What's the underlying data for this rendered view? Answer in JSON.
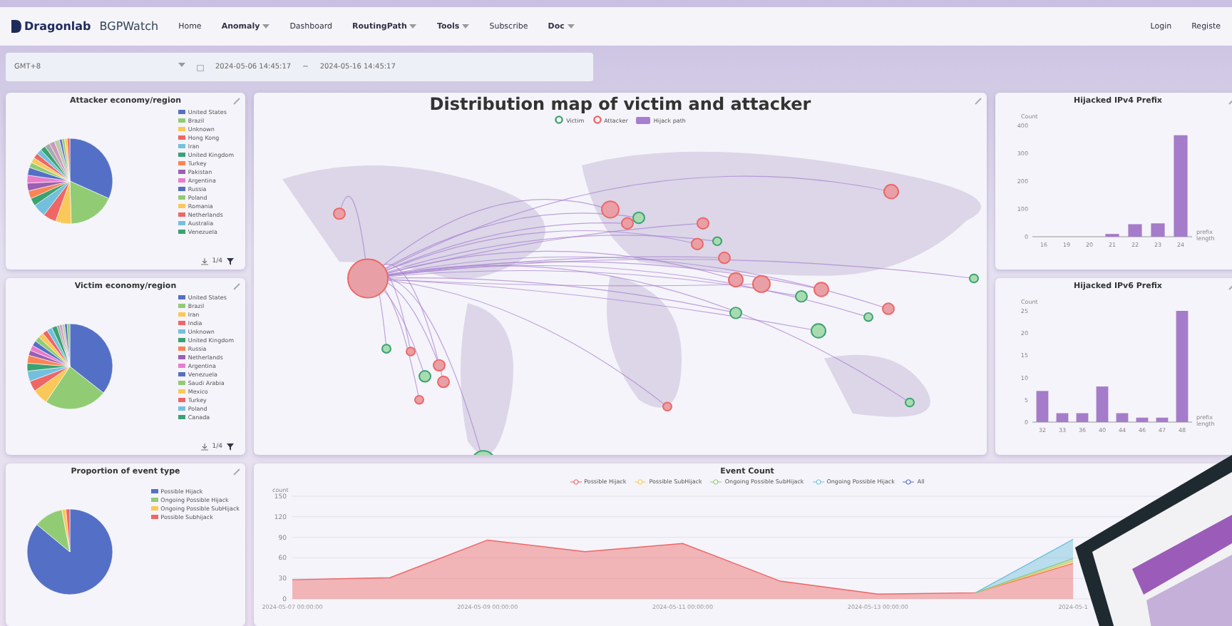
{
  "nav": {
    "brand": "Dragonlab",
    "product": "BGPWatch",
    "items": [
      {
        "label": "Home",
        "bold": false,
        "dropdown": false
      },
      {
        "label": "Anomaly",
        "bold": true,
        "dropdown": true
      },
      {
        "label": "Dashboard",
        "bold": false,
        "dropdown": false
      },
      {
        "label": "RoutingPath",
        "bold": true,
        "dropdown": true
      },
      {
        "label": "Tools",
        "bold": true,
        "dropdown": true
      },
      {
        "label": "Subscribe",
        "bold": false,
        "dropdown": false
      },
      {
        "label": "Doc",
        "bold": true,
        "dropdown": true
      }
    ],
    "right": [
      "Login",
      "Registe"
    ]
  },
  "filter": {
    "timezone": "GMT+8",
    "start": "2024-05-06 14:45:17",
    "separator": "~",
    "end": "2024-05-16 14:45:17"
  },
  "attacker_panel": {
    "title": "Attacker economy/region",
    "page": "1/4",
    "legend": [
      {
        "label": "United States",
        "color": "#5470c6"
      },
      {
        "label": "Brazil",
        "color": "#91cc75"
      },
      {
        "label": "Unknown",
        "color": "#fac858"
      },
      {
        "label": "Hong Kong",
        "color": "#ee6666"
      },
      {
        "label": "Iran",
        "color": "#73c0de"
      },
      {
        "label": "United Kingdom",
        "color": "#3ba272"
      },
      {
        "label": "Turkey",
        "color": "#fc8452"
      },
      {
        "label": "Pakistan",
        "color": "#9a60b4"
      },
      {
        "label": "Argentina",
        "color": "#ea7ccc"
      },
      {
        "label": "Russia",
        "color": "#5470c6"
      },
      {
        "label": "Poland",
        "color": "#91cc75"
      },
      {
        "label": "Romania",
        "color": "#fac858"
      },
      {
        "label": "Netherlands",
        "color": "#ee6666"
      },
      {
        "label": "Australia",
        "color": "#73c0de"
      },
      {
        "label": "Venezuela",
        "color": "#3ba272"
      }
    ]
  },
  "victim_panel": {
    "title": "Victim economy/region",
    "page": "1/4",
    "legend": [
      {
        "label": "United States",
        "color": "#5470c6"
      },
      {
        "label": "Brazil",
        "color": "#91cc75"
      },
      {
        "label": "Iran",
        "color": "#fac858"
      },
      {
        "label": "India",
        "color": "#ee6666"
      },
      {
        "label": "Unknown",
        "color": "#73c0de"
      },
      {
        "label": "United Kingdom",
        "color": "#3ba272"
      },
      {
        "label": "Russia",
        "color": "#fc8452"
      },
      {
        "label": "Netherlands",
        "color": "#9a60b4"
      },
      {
        "label": "Argentina",
        "color": "#ea7ccc"
      },
      {
        "label": "Venezuela",
        "color": "#5470c6"
      },
      {
        "label": "Saudi Arabia",
        "color": "#91cc75"
      },
      {
        "label": "Mexico",
        "color": "#fac858"
      },
      {
        "label": "Turkey",
        "color": "#ee6666"
      },
      {
        "label": "Poland",
        "color": "#73c0de"
      },
      {
        "label": "Canada",
        "color": "#3ba272"
      }
    ]
  },
  "map_panel": {
    "title": "Distribution map of victim and attacker",
    "legend": [
      {
        "label": "Victim",
        "kind": "victim",
        "color": "#3ba272"
      },
      {
        "label": "Attacker",
        "kind": "attacker",
        "color": "#ee6666"
      },
      {
        "label": "Hijack path",
        "kind": "path",
        "color": "#a77fd0"
      }
    ]
  },
  "ipv4_panel": {
    "title": "Hijacked IPv4 Prefix",
    "chart_data": {
      "type": "bar",
      "ylabel": "Count",
      "xlabel": "prefix length",
      "categories": [
        "16",
        "19",
        "20",
        "21",
        "22",
        "23",
        "24"
      ],
      "values": [
        0,
        0,
        0,
        10,
        45,
        48,
        365
      ],
      "ylim": [
        0,
        400
      ],
      "yticks": [
        0,
        100,
        200,
        300,
        400
      ]
    }
  },
  "ipv6_panel": {
    "title": "Hijacked IPv6 Prefix",
    "chart_data": {
      "type": "bar",
      "ylabel": "Count",
      "xlabel": "prefix length",
      "categories": [
        "32",
        "33",
        "36",
        "40",
        "44",
        "46",
        "47",
        "48"
      ],
      "values": [
        7,
        2,
        2,
        8,
        2,
        1,
        1,
        25
      ],
      "ylim": [
        0,
        25
      ],
      "yticks": [
        0,
        5,
        10,
        15,
        20,
        25
      ]
    }
  },
  "event_type_panel": {
    "title": "Proportion of event type",
    "legend": [
      {
        "label": "Possible Hijack",
        "color": "#5470c6"
      },
      {
        "label": "Ongoing Possible Hijack",
        "color": "#91cc75"
      },
      {
        "label": "Ongoing Possible SubHijack",
        "color": "#fac858"
      },
      {
        "label": "Possible Subhijack",
        "color": "#ee6666"
      }
    ]
  },
  "event_count_panel": {
    "title": "Event Count",
    "chart_data": {
      "type": "area",
      "ylabel": "count",
      "x": [
        "2024-05-07 00:00:00",
        null,
        "2024-05-09 00:00:00",
        null,
        "2024-05-11 00:00:00",
        null,
        "2024-05-13 00:00:00",
        null,
        "2024-05-1",
        null
      ],
      "ylim": [
        0,
        150
      ],
      "yticks": [
        0,
        30,
        60,
        90,
        120,
        150
      ],
      "stacked": true,
      "grid": true,
      "series": [
        {
          "name": "Possible Hijack",
          "color": "#ee6666",
          "values": [
            28,
            31,
            86,
            69,
            81,
            26,
            7,
            9,
            52,
            null
          ]
        },
        {
          "name": "Possible SubHijack",
          "color": "#fac858",
          "values": [
            null,
            null,
            null,
            null,
            null,
            null,
            null,
            0,
            3,
            null
          ]
        },
        {
          "name": "Ongoing Possible SubHijack",
          "color": "#91cc75",
          "values": [
            null,
            null,
            null,
            null,
            null,
            null,
            null,
            0,
            4,
            null
          ]
        },
        {
          "name": "Ongoing Possible Hijack",
          "color": "#73c0de",
          "values": [
            null,
            null,
            null,
            null,
            null,
            null,
            null,
            0,
            28,
            null
          ]
        },
        {
          "name": "All",
          "color": "#5470c6",
          "values": [
            null,
            null,
            null,
            null,
            null,
            null,
            null,
            null,
            null,
            null
          ]
        }
      ]
    }
  }
}
